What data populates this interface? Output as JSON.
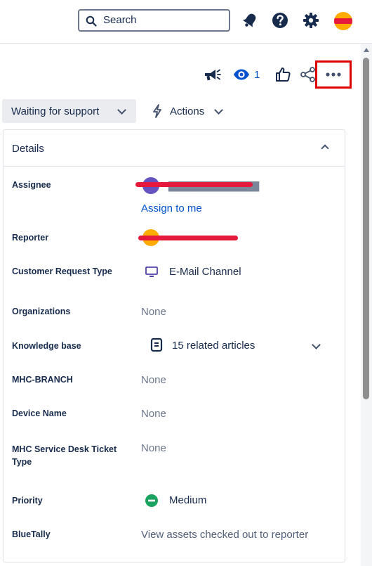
{
  "topbar": {
    "search_placeholder": "Search",
    "icons": [
      "notifications-icon",
      "help-icon",
      "settings-icon",
      "profile-avatar"
    ]
  },
  "issue_actions": {
    "watch_count": "1",
    "icons": [
      "feedback-icon",
      "watch-icon",
      "like-icon",
      "share-icon",
      "more-icon"
    ]
  },
  "status": {
    "label": "Waiting for support",
    "actions_label": "Actions"
  },
  "details": {
    "title": "Details",
    "assignee": {
      "label": "Assignee",
      "assign_to_me": "Assign to me",
      "avatar_color": "#6554c0"
    },
    "reporter": {
      "label": "Reporter",
      "avatar_color": "#ffab00"
    },
    "request_type": {
      "label": "Customer Request Type",
      "value": "E-Mail Channel"
    },
    "organizations": {
      "label": "Organizations",
      "value": "None"
    },
    "knowledge_base": {
      "label": "Knowledge base",
      "value": "15 related articles"
    },
    "mhc_branch": {
      "label": "MHC-BRANCH",
      "value": "None"
    },
    "device_name": {
      "label": "Device Name",
      "value": "None"
    },
    "ticket_type": {
      "label": "MHC Service Desk Ticket Type",
      "value": "None"
    },
    "priority": {
      "label": "Priority",
      "value": "Medium",
      "color": "#1aa35e"
    },
    "bluetally": {
      "label": "BlueTally",
      "value": "View assets checked out to reporter"
    }
  },
  "colors": {
    "link": "#0052cc",
    "highlight_border": "#e00000",
    "redaction": "#e5193b"
  }
}
